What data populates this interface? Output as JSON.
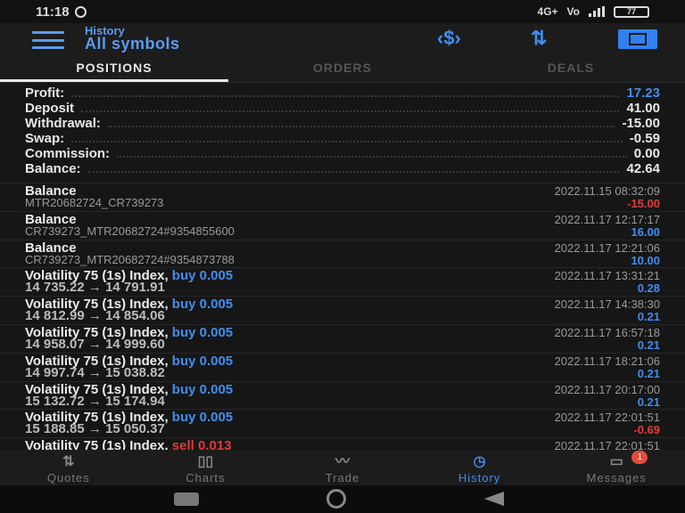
{
  "status_bar": {
    "time": "11:18",
    "network": "4G+",
    "volte": "Vo",
    "battery": "77"
  },
  "header": {
    "subtitle": "History",
    "title": "All symbols",
    "icons": [
      "menu-icon",
      "currency-exchange-icon",
      "sort-icon",
      "calendar-icon"
    ]
  },
  "tabs": [
    {
      "label": "POSITIONS",
      "active": true
    },
    {
      "label": "ORDERS",
      "active": false
    },
    {
      "label": "DEALS",
      "active": false
    }
  ],
  "summary": [
    {
      "label": "Profit:",
      "value": "17.23",
      "color": "#3f8ef0"
    },
    {
      "label": "Deposit",
      "value": "41.00"
    },
    {
      "label": "Withdrawal:",
      "value": "-15.00"
    },
    {
      "label": "Swap:",
      "value": "-0.59"
    },
    {
      "label": "Commission:",
      "value": "0.00"
    },
    {
      "label": "Balance:",
      "value": "42.64"
    }
  ],
  "rows": [
    {
      "title": "Balance",
      "side": "",
      "sub": "MTR20682724_CR739273",
      "time": "2022.11.15 08:32:09",
      "amount": "-15.00",
      "amount_color": "neg"
    },
    {
      "title": "Balance",
      "side": "",
      "sub": "CR739273_MTR20682724#9354855600",
      "time": "2022.11.17 12:17:17",
      "amount": "16.00",
      "amount_color": "pos"
    },
    {
      "title": "Balance",
      "side": "",
      "sub": "CR739273_MTR20682724#9354873788",
      "time": "2022.11.17 12:21:06",
      "amount": "10.00",
      "amount_color": "pos"
    },
    {
      "title": "Volatility 75 (1s) Index,",
      "side": "buy 0.005",
      "sub": "14 735.22 → 14 791.91",
      "time": "2022.11.17 13:31:21",
      "amount": "0.28",
      "amount_color": "pos"
    },
    {
      "title": "Volatility 75 (1s) Index,",
      "side": "buy 0.005",
      "sub": "14 812.99 → 14 854.06",
      "time": "2022.11.17 14:38:30",
      "amount": "0.21",
      "amount_color": "pos"
    },
    {
      "title": "Volatility 75 (1s) Index,",
      "side": "buy 0.005",
      "sub": "14 958.07 → 14 999.60",
      "time": "2022.11.17 16:57:18",
      "amount": "0.21",
      "amount_color": "pos"
    },
    {
      "title": "Volatility 75 (1s) Index,",
      "side": "buy 0.005",
      "sub": "14 997.74 → 15 038.82",
      "time": "2022.11.17 18:21:06",
      "amount": "0.21",
      "amount_color": "pos"
    },
    {
      "title": "Volatility 75 (1s) Index,",
      "side": "buy 0.005",
      "sub": "15 132.72 → 15 174.94",
      "time": "2022.11.17 20:17:00",
      "amount": "0.21",
      "amount_color": "pos"
    },
    {
      "title": "Volatility 75 (1s) Index,",
      "side": "buy 0.005",
      "sub": "15 188.85 → 15 050.37",
      "time": "2022.11.17 22:01:51",
      "amount": "-0.69",
      "amount_color": "neg"
    },
    {
      "title": "Volatility 75 (1s) Index,",
      "side": "sell 0.013",
      "sub": "",
      "time": "2022.11.17 22:01:51",
      "amount": "",
      "amount_color": "pos"
    }
  ],
  "bottom_nav": [
    {
      "label": "Quotes",
      "icon": "quotes-icon",
      "active": false
    },
    {
      "label": "Charts",
      "icon": "charts-icon",
      "active": false
    },
    {
      "label": "Trade",
      "icon": "trade-icon",
      "active": false
    },
    {
      "label": "History",
      "icon": "history-icon",
      "active": true
    },
    {
      "label": "Messages",
      "icon": "messages-icon",
      "active": false,
      "badge": "1"
    }
  ],
  "colors": {
    "accent": "#3f8ef0",
    "loss": "#e23a3a",
    "background": "#161616"
  }
}
